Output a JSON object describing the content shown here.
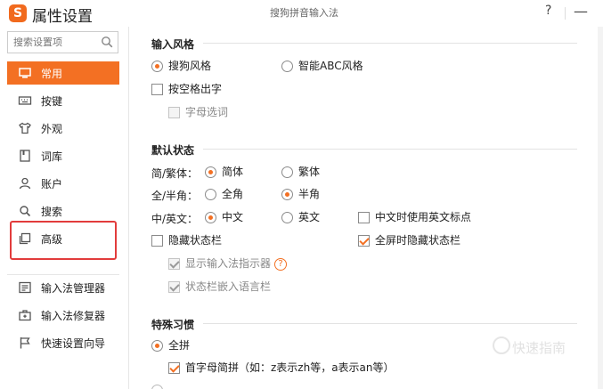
{
  "app": {
    "logo_glyph": "S",
    "title": "属性设置",
    "window_title": "搜狗拼音输入法",
    "help_glyph": "?",
    "minimize_glyph": "—",
    "accent_color": "#f37023",
    "highlight_color": "#e23c3c"
  },
  "sidebar": {
    "search_placeholder": "搜索设置项",
    "items": [
      {
        "label": "常用",
        "icon": "monitor-icon",
        "active": true
      },
      {
        "label": "按键",
        "icon": "keyboard-icon",
        "active": false
      },
      {
        "label": "外观",
        "icon": "shirt-icon",
        "active": false
      },
      {
        "label": "词库",
        "icon": "book-icon",
        "active": false
      },
      {
        "label": "账户",
        "icon": "user-icon",
        "active": false
      },
      {
        "label": "搜索",
        "icon": "search-icon",
        "active": false
      },
      {
        "label": "高级",
        "icon": "layers-icon",
        "active": false,
        "highlighted": true
      }
    ],
    "tools": [
      {
        "label": "输入法管理器",
        "icon": "manager-icon"
      },
      {
        "label": "输入法修复器",
        "icon": "repair-icon"
      },
      {
        "label": "快速设置向导",
        "icon": "flag-icon"
      }
    ]
  },
  "input_style": {
    "title": "输入风格",
    "sogou_style": {
      "label": "搜狗风格",
      "selected": true
    },
    "abc_style": {
      "label": "智能ABC风格",
      "selected": false
    },
    "space_output": {
      "label": "按空格出字",
      "checked": false
    },
    "letter_select": {
      "label": "字母选词",
      "checked": false,
      "disabled": true
    }
  },
  "default_state": {
    "title": "默认状态",
    "script_label": "简/繁体：",
    "simplified": {
      "label": "简体",
      "selected": true
    },
    "traditional": {
      "label": "繁体",
      "selected": false
    },
    "width_label": "全/半角：",
    "full_width": {
      "label": "全角",
      "selected": false
    },
    "half_width": {
      "label": "半角",
      "selected": true
    },
    "lang_label": "中/英文：",
    "chinese": {
      "label": "中文",
      "selected": true
    },
    "english": {
      "label": "英文",
      "selected": false
    },
    "en_punct": {
      "label": "中文时使用英文标点",
      "checked": false
    },
    "hide_status": {
      "label": "隐藏状态栏",
      "checked": false
    },
    "hide_fullscreen": {
      "label": "全屏时隐藏状态栏",
      "checked": true
    },
    "show_indicator": {
      "label": "显示输入法指示器",
      "checked": true,
      "disabled": true
    },
    "embed_langbar": {
      "label": "状态栏嵌入语言栏",
      "checked": true,
      "disabled": true
    }
  },
  "special_habits": {
    "title": "特殊习惯",
    "full_pinyin": {
      "label": "全拼",
      "selected": true
    },
    "initial_abbrev": {
      "label": "首字母简拼（如：z表示zh等，a表示an等）",
      "checked": true
    }
  },
  "watermark": "快速指南"
}
